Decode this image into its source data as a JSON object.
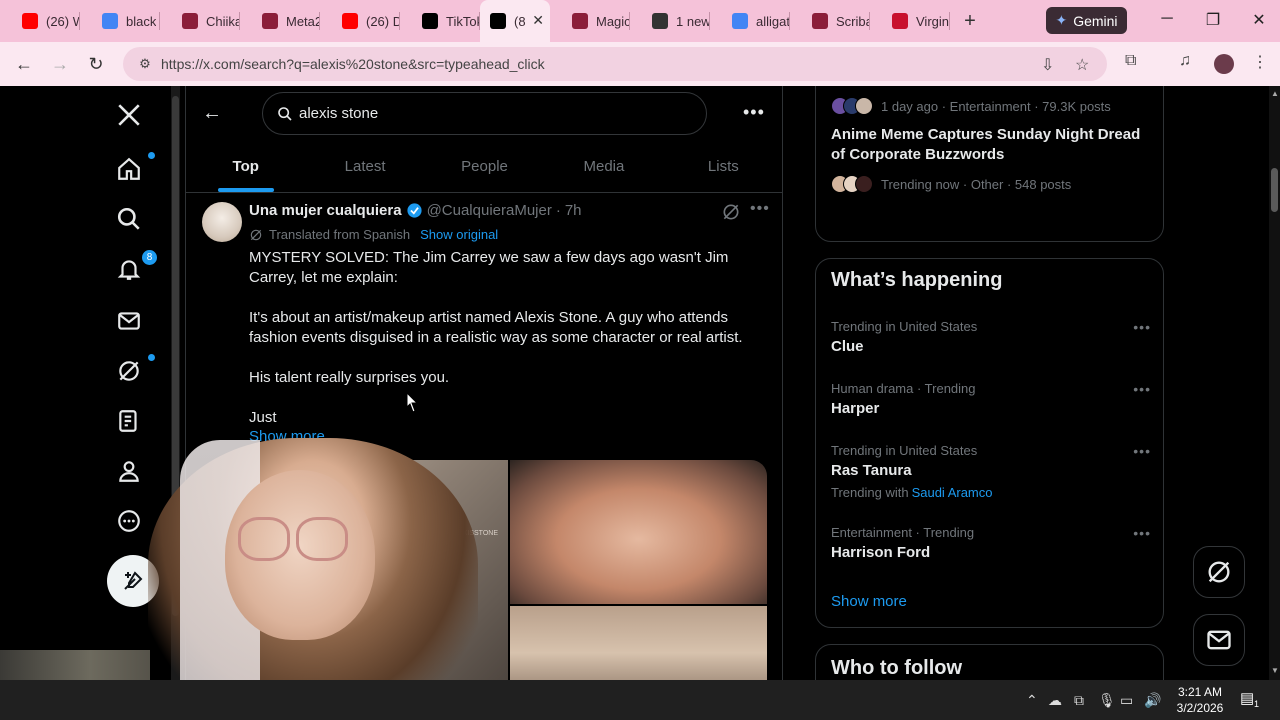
{
  "browser": {
    "tabs": [
      {
        "title": "(26) W",
        "favicon": "youtube-icon",
        "color": "#ff0000"
      },
      {
        "title": "black",
        "favicon": "google-icon",
        "color": "#4285f4"
      },
      {
        "title": "Chiika",
        "favicon": "bookmark-icon",
        "color": "#8b1d3a"
      },
      {
        "title": "Meta2",
        "favicon": "bookmark-icon",
        "color": "#8b1d3a"
      },
      {
        "title": "(26) D",
        "favicon": "youtube-icon",
        "color": "#ff0000"
      },
      {
        "title": "TikTok",
        "favicon": "tiktok-icon",
        "color": "#000000"
      },
      {
        "title": "(8",
        "favicon": "x-icon",
        "color": "#000000",
        "active": true
      },
      {
        "title": "Magic",
        "favicon": "bookmark-icon",
        "color": "#8b1d3a"
      },
      {
        "title": "1 new",
        "favicon": "e-icon",
        "color": "#333333"
      },
      {
        "title": "alligat",
        "favicon": "google-icon",
        "color": "#4285f4"
      },
      {
        "title": "Scriba",
        "favicon": "scribd-icon",
        "color": "#8b1d3a"
      },
      {
        "title": "Virgin",
        "favicon": "v-icon",
        "color": "#c8102e"
      }
    ],
    "gemini_label": "Gemini",
    "url": "https://x.com/search?q=alexis%20stone&src=typeahead_click"
  },
  "nav": {
    "notifications_badge": "8"
  },
  "search": {
    "query": "alexis stone",
    "tabs": [
      "Top",
      "Latest",
      "People",
      "Media",
      "Lists"
    ]
  },
  "post": {
    "name": "Una mujer cualquiera",
    "handle": "@CualquieraMujer",
    "separator": "·",
    "time": "7h",
    "translated_label": "Translated from Spanish",
    "show_original": "Show original",
    "paragraphs": [
      "MYSTERY SOLVED: The Jim Carrey we saw a few days ago wasn't Jim Carrey, let me explain:",
      "It's about an artist/makeup artist named Alexis Stone. A guy who attends fashion events disguised in a realistic way as some character or real artist.",
      "His talent really surprises you.",
      "Just"
    ],
    "show_more": "Show more",
    "media_watermark": "@THEALEXISSTONE"
  },
  "sidebar": {
    "top_trend": {
      "meta": "1 day ago · Entertainment · 79.3K posts"
    },
    "story2": {
      "title": "Anime Meme Captures Sunday Night Dread of Corporate Buzzwords",
      "meta": "Trending now · Other · 548 posts"
    },
    "whats_happening": {
      "heading": "What’s happening",
      "trends": [
        {
          "context": "Trending in United States",
          "title": "Clue"
        },
        {
          "context": "Human drama · Trending",
          "title": "Harper"
        },
        {
          "context": "Trending in United States",
          "title": "Ras Tanura",
          "with_label": "Trending with",
          "with_link": "Saudi Aramco"
        },
        {
          "context": "Entertainment · Trending",
          "title": "Harrison Ford"
        }
      ],
      "show_more": "Show more"
    },
    "who_to_follow": {
      "heading": "Who to follow"
    }
  },
  "taskbar": {
    "time": "3:21 AM",
    "date": "3/2/2026",
    "notification_count": "1"
  },
  "colors": {
    "accent": "#1d9bf0",
    "chrome_pink": "#f5c2d9",
    "text_primary": "#e7e9ea",
    "text_secondary": "#71767b"
  }
}
